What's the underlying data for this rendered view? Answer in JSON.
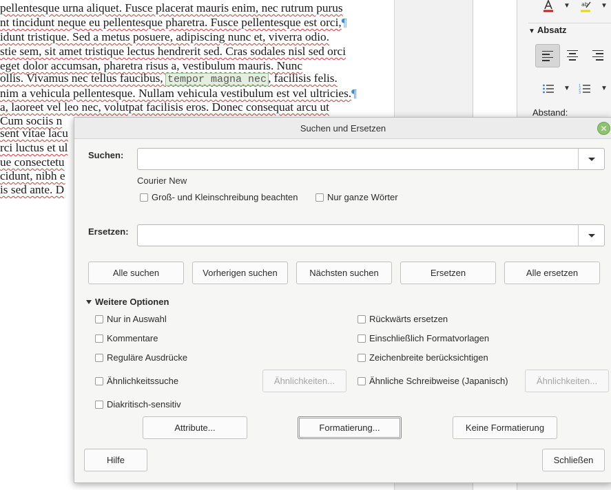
{
  "document": {
    "lines": [
      "pellentesque urna aliquet. Fusce placerat mauris enim, nec rutrum purus",
      "nt tincidunt neque eu pellentesque pharetra. Fusce pellentesque est orci,",
      "idunt tristique. Sed a metus posuere, adipiscing nunc et, viverra odio.",
      "stie sem, sit amet tristique lectus hendrerit sed. Cras sodales nisl sed orci",
      " eget dolor accumsan, pharetra risus a, vestibulum mauris. Nunc",
      "ollis. Vivamus nec tellus faucibus, ",
      "nim a vehicula pellentesque. Nullam vehicula vestibulum est vel ultricies.",
      "a, laoreet vel leo nec, volutpat facilisis eros. Donec consequat arcu ut",
      " Cum sociis n",
      "sent vitae lacu",
      "rci luctus et ul",
      "ue consectetu",
      "cidunt, nibh e",
      "is sed ante. D"
    ],
    "highlight_text": "tempor magna nec",
    "after_highlight": ", facilisis felis.",
    "para_mark": "¶"
  },
  "sidebar": {
    "section_title": "Absatz",
    "spacing_label": "Abstand:"
  },
  "dialog": {
    "title": "Suchen und Ersetzen",
    "search_label": "Suchen:",
    "search_value": "",
    "font_hint": "Courier New",
    "match_case": "Groß- und Kleinschreibung beachten",
    "whole_words": "Nur ganze Wörter",
    "replace_label": "Ersetzen:",
    "replace_value": "",
    "buttons": {
      "find_all": "Alle suchen",
      "find_prev": "Vorherigen suchen",
      "find_next": "Nächsten suchen",
      "replace": "Ersetzen",
      "replace_all": "Alle ersetzen"
    },
    "more_options": "Weitere Optionen",
    "options": {
      "current_selection": "Nur in Auswahl",
      "comments": "Kommentare",
      "regex": "Reguläre Ausdrücke",
      "similarity": "Ähnlichkeitssuche",
      "diacritics": "Diakritisch-sensitiv",
      "backwards": "Rückwärts ersetzen",
      "styles": "Einschließlich Formatvorlagen",
      "char_width": "Zeichenbreite berücksichtigen",
      "sounds_like": "Ähnliche Schreibweise (Japanisch)"
    },
    "similarity_button": "Ähnlichkeiten...",
    "sounds_like_button": "Ähnlichkeiten...",
    "attributes_button": "Attribute...",
    "format_button": "Formatierung...",
    "no_format_button": "Keine Formatierung",
    "help_button": "Hilfe",
    "close_button": "Schließen"
  },
  "colors": {
    "dialog_bg": "#f6f6f5",
    "close_icon": "#8cc36f",
    "spell_underline": "#e23333",
    "para_mark": "#3a8fd8"
  }
}
